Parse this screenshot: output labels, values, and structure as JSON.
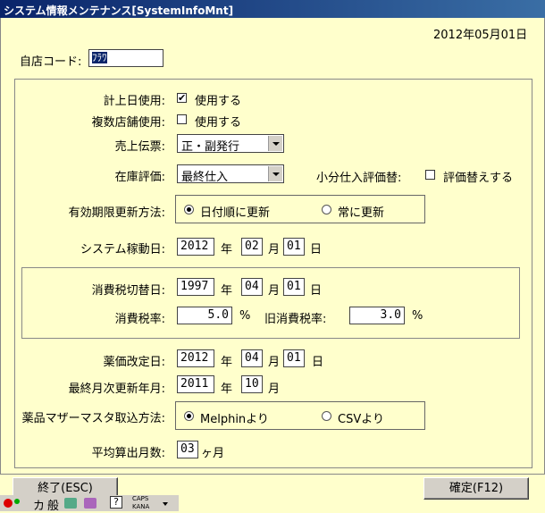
{
  "window": {
    "title": "システム情報メンテナンス[SystemInfoMnt]"
  },
  "header": {
    "date": "2012年05月01日"
  },
  "store_code": {
    "label": "自店コード:",
    "value": "ﾌﾗﾜ"
  },
  "keijo_date": {
    "label": "計上日使用:",
    "checked": true,
    "option_label": "使用する"
  },
  "multi_store": {
    "label": "複数店舗使用:",
    "checked": false,
    "option_label": "使用する"
  },
  "sales_slip": {
    "label": "売上伝票:",
    "selected": "正・副発行"
  },
  "stock_eval": {
    "label": "在庫評価:",
    "selected": "最終仕入"
  },
  "small_purchase": {
    "label": "小分仕入評価替:",
    "checked": false,
    "option_label": "評価替えする"
  },
  "expiry_update": {
    "label": "有効期限更新方法:",
    "options": [
      "日付順に更新",
      "常に更新"
    ],
    "selected_index": 0
  },
  "system_start": {
    "label": "システム稼動日:",
    "year": "2012",
    "month": "02",
    "day": "01"
  },
  "units": {
    "year": "年",
    "month": "月",
    "day": "日",
    "percent": "%",
    "months_suffix": "ヶ月"
  },
  "tax_switch": {
    "label": "消費税切替日:",
    "year": "1997",
    "month": "04",
    "day": "01"
  },
  "tax_rate": {
    "label": "消費税率:",
    "value": "5.0"
  },
  "old_tax_rate": {
    "label": "旧消費税率:",
    "value": "3.0"
  },
  "price_revision": {
    "label": "薬価改定日:",
    "year": "2012",
    "month": "04",
    "day": "01"
  },
  "last_monthly": {
    "label": "最終月次更新年月:",
    "year": "2011",
    "month": "10"
  },
  "master_import": {
    "label": "薬品マザーマスタ取込方法:",
    "options": [
      "Melphinより",
      "CSVより"
    ],
    "selected_index": 0
  },
  "avg_months": {
    "label": "平均算出月数:",
    "value": "03"
  },
  "buttons": {
    "exit": "終了(ESC)",
    "confirm": "確定(F12)"
  },
  "taskbar": {
    "ime_mode": "カ",
    "ime_conv": "般",
    "caps": "CAPS",
    "kana": "KANA",
    "help": "?"
  }
}
